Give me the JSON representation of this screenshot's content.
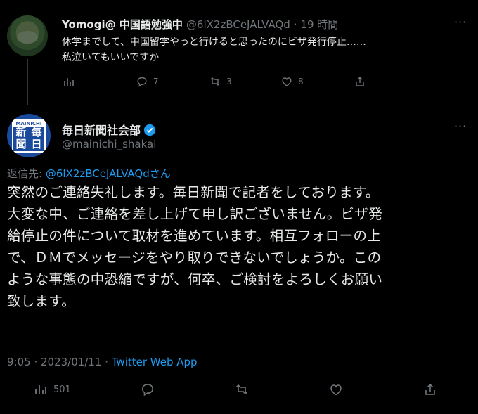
{
  "reply_tweet": {
    "display_name": "Yomogi@ 中国語勉強中",
    "handle": "@6lX2zBCeJALVAQd",
    "time": "· 19 時間",
    "text_line1": "休学までして、中国留学やっと行けると思ったのにビザ発行停止……",
    "text_line2": "私泣いてもいいですか",
    "stats": {
      "views": "",
      "replies": "7",
      "retweets": "3",
      "likes": "8"
    }
  },
  "main_tweet": {
    "display_name": "毎日新聞社会部",
    "handle": "@mainichi_shakai",
    "avatar_text": [
      "新",
      "毎",
      "聞",
      "日"
    ],
    "avatar_label": "MAINICHI",
    "reply_prefix": "返信先: ",
    "reply_handle": "@6lX2zBCeJALVAQd",
    "reply_suffix": "さん",
    "text_lines": [
      "突然のご連絡失礼します。毎日新聞で記者をしております。",
      "大変な中、ご連絡を差し上げて申し訳ございません。ビザ発",
      "給停止の件について取材を進めています。相互フォローの上",
      "で、ＤＭでメッセージをやり取りできないでしょうか。この",
      "ような事態の中恐縮ですが、何卒、ご検討をよろしくお願い",
      "致します。"
    ],
    "time": "9:05 · 2023/01/11 · ",
    "source": "Twitter Web App",
    "stats": {
      "views": "501"
    }
  },
  "colors": {
    "background": "#000000",
    "text": "#e7e9ea",
    "muted": "#71767b",
    "link": "#1d9bf0"
  },
  "icons": [
    "views-icon",
    "reply-icon",
    "retweet-icon",
    "like-icon",
    "share-icon",
    "more-icon",
    "verified-icon"
  ]
}
